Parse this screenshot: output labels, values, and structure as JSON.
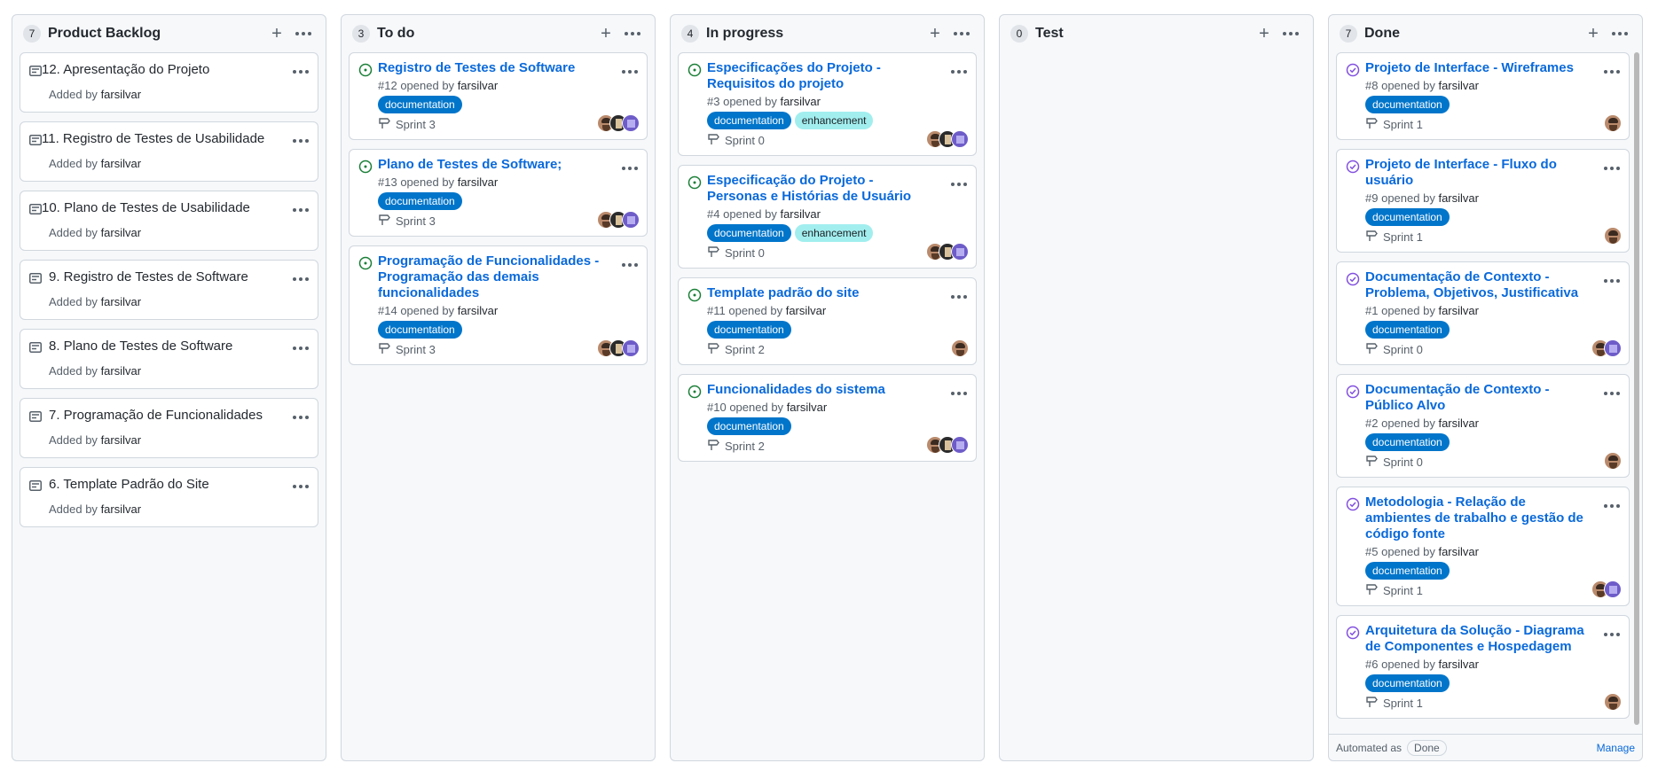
{
  "columns": [
    {
      "count": "7",
      "title": "Product Backlog",
      "notes": [
        {
          "title": "12. Apresentação do Projeto",
          "added_by": "Added by",
          "user": "farsilvar"
        },
        {
          "title": "11. Registro de Testes de Usabilidade",
          "added_by": "Added by",
          "user": "farsilvar"
        },
        {
          "title": "10. Plano de Testes de Usabilidade",
          "added_by": "Added by",
          "user": "farsilvar"
        },
        {
          "title": "9. Registro de Testes de Software",
          "added_by": "Added by",
          "user": "farsilvar"
        },
        {
          "title": "8. Plano de Testes de Software",
          "added_by": "Added by",
          "user": "farsilvar"
        },
        {
          "title": "7. Programação de Funcionalidades",
          "added_by": "Added by",
          "user": "farsilvar"
        },
        {
          "title": "6. Template Padrão do Site",
          "added_by": "Added by",
          "user": "farsilvar"
        }
      ]
    },
    {
      "count": "3",
      "title": "To do",
      "issues": [
        {
          "title": "Registro de Testes de Software",
          "number": "#12",
          "opened": "opened by",
          "user": "farsilvar",
          "labels": [
            "documentation"
          ],
          "milestone": "Sprint 3"
        },
        {
          "title": "Plano de Testes de Software;",
          "number": "#13",
          "opened": "opened by",
          "user": "farsilvar",
          "labels": [
            "documentation"
          ],
          "milestone": "Sprint 3"
        },
        {
          "title": "Programação de Funcionalidades - Programação das demais funcionalidades",
          "number": "#14",
          "opened": "opened by",
          "user": "farsilvar",
          "labels": [
            "documentation"
          ],
          "milestone": "Sprint 3"
        }
      ]
    },
    {
      "count": "4",
      "title": "In progress",
      "issues": [
        {
          "title": "Especificações do Projeto - Requisitos do projeto",
          "number": "#3",
          "opened": "opened by",
          "user": "farsilvar",
          "labels": [
            "documentation",
            "enhancement"
          ],
          "milestone": "Sprint 0"
        },
        {
          "title": "Especificação do Projeto - Personas e Histórias de Usuário",
          "number": "#4",
          "opened": "opened by",
          "user": "farsilvar",
          "labels": [
            "documentation",
            "enhancement"
          ],
          "milestone": "Sprint 0"
        },
        {
          "title": "Template padrão do site",
          "number": "#11",
          "opened": "opened by",
          "user": "farsilvar",
          "labels": [
            "documentation"
          ],
          "milestone": "Sprint 2"
        },
        {
          "title": "Funcionalidades do sistema",
          "number": "#10",
          "opened": "opened by",
          "user": "farsilvar",
          "labels": [
            "documentation"
          ],
          "milestone": "Sprint 2"
        }
      ]
    },
    {
      "count": "0",
      "title": "Test"
    },
    {
      "count": "7",
      "title": "Done",
      "issues": [
        {
          "title": "Projeto de Interface - Wireframes",
          "number": "#8",
          "opened": "opened by",
          "user": "farsilvar",
          "labels": [
            "documentation"
          ],
          "milestone": "Sprint 1"
        },
        {
          "title": "Projeto de Interface - Fluxo do usuário",
          "number": "#9",
          "opened": "opened by",
          "user": "farsilvar",
          "labels": [
            "documentation"
          ],
          "milestone": "Sprint 1"
        },
        {
          "title": "Documentação de Contexto - Problema, Objetivos, Justificativa",
          "number": "#1",
          "opened": "opened by",
          "user": "farsilvar",
          "labels": [
            "documentation"
          ],
          "milestone": "Sprint 0"
        },
        {
          "title": "Documentação de Contexto - Público Alvo",
          "number": "#2",
          "opened": "opened by",
          "user": "farsilvar",
          "labels": [
            "documentation"
          ],
          "milestone": "Sprint 0"
        },
        {
          "title": "Metodologia - Relação de ambientes de trabalho e gestão de código fonte",
          "number": "#5",
          "opened": "opened by",
          "user": "farsilvar",
          "labels": [
            "documentation"
          ],
          "milestone": "Sprint 1"
        },
        {
          "title": "Arquitetura da Solução - Diagrama de Componentes e Hospedagem",
          "number": "#6",
          "opened": "opened by",
          "user": "farsilvar",
          "labels": [
            "documentation"
          ],
          "milestone": "Sprint 1"
        }
      ],
      "footer": {
        "automated": "Automated as",
        "state": "Done",
        "manage": "Manage"
      }
    }
  ],
  "colors": {
    "open_icon": "#1a7f37",
    "closed_icon": "#8250df",
    "link": "#0969da",
    "label_documentation": "#0075ca",
    "label_enhancement": "#a2eeef"
  }
}
